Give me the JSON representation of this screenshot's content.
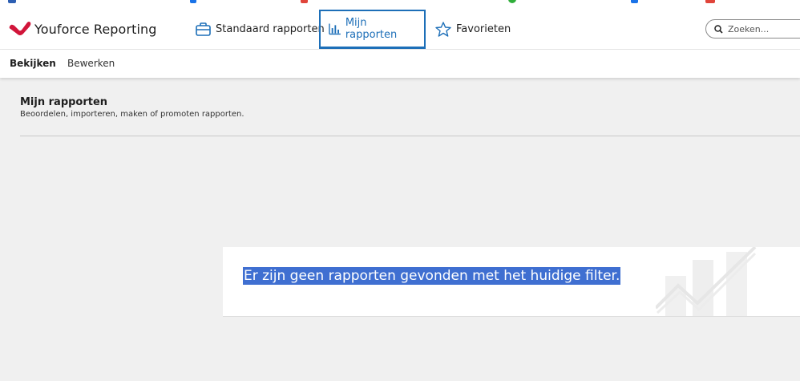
{
  "app": {
    "title": "Youforce Reporting",
    "brand_color": "#d1153a",
    "accent_color": "#1d6fb8"
  },
  "nav": {
    "tabs": [
      {
        "label": "Standaard rapporten",
        "icon": "briefcase-icon"
      },
      {
        "label": "Mijn rapporten",
        "icon": "bar-chart-icon",
        "active": true
      },
      {
        "label": "Favorieten",
        "icon": "star-icon"
      }
    ]
  },
  "search": {
    "placeholder": "Zoeken...",
    "icon": "search-icon"
  },
  "subnav": {
    "tabs": [
      {
        "label": "Bekijken",
        "active": true
      },
      {
        "label": "Bewerken"
      }
    ]
  },
  "page": {
    "title": "Mijn rapporten",
    "subtitle": "Beoordelen, importeren, maken of promoten rapporten."
  },
  "empty_state": {
    "message": "Er zijn geen rapporten gevonden met het huidige filter.",
    "illustration": "chart-illustration-icon",
    "highlight_color": "#3f6fd1"
  }
}
